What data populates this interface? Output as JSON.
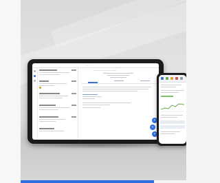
{
  "photo": {
    "tablet_app": {
      "header_title": "·····",
      "detail_title": "·········· ········ ·· ·······"
    },
    "phone_app": {},
    "accent_color": "#2f6fe0",
    "tag_color": "#e0a030"
  }
}
